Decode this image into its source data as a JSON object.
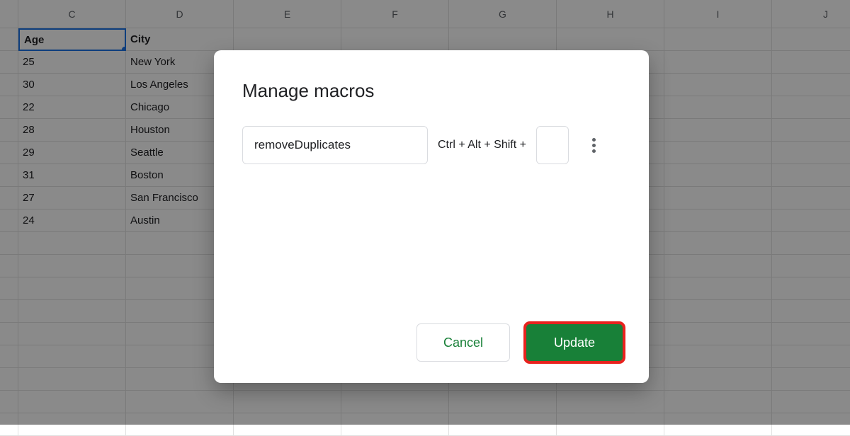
{
  "spreadsheet": {
    "columns": [
      "",
      "C",
      "D",
      "E",
      "F",
      "G",
      "H",
      "I",
      "J"
    ],
    "header_c": "Age",
    "header_d": "City",
    "rows": [
      {
        "c": "25",
        "d": "New York"
      },
      {
        "c": "30",
        "d": "Los Angeles"
      },
      {
        "c": "22",
        "d": "Chicago"
      },
      {
        "c": "28",
        "d": "Houston"
      },
      {
        "c": "29",
        "d": "Seattle"
      },
      {
        "c": "31",
        "d": "Boston"
      },
      {
        "c": "27",
        "d": "San Francisco"
      },
      {
        "c": "24",
        "d": "Austin"
      }
    ]
  },
  "dialog": {
    "title": "Manage macros",
    "macro_name": "removeDuplicates",
    "shortcut_prefix": "Ctrl + Alt + Shift +",
    "shortcut_key": "",
    "cancel_label": "Cancel",
    "update_label": "Update"
  }
}
